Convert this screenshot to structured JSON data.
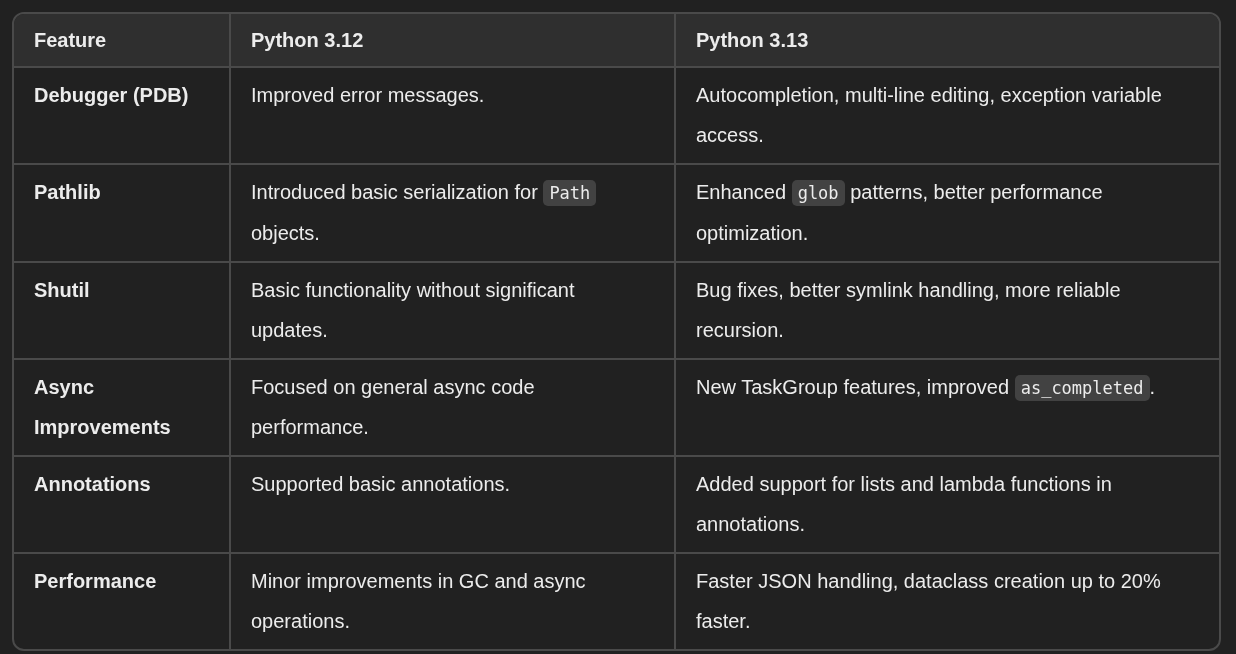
{
  "table": {
    "columns": [
      "Feature",
      "Python 3.12",
      "Python 3.13"
    ],
    "rows": [
      [
        [
          {
            "kind": "text",
            "text": "Debugger (PDB)"
          }
        ],
        [
          {
            "kind": "text",
            "text": "Improved error messages."
          }
        ],
        [
          {
            "kind": "text",
            "text": "Autocompletion, multi-line editing, exception variable access."
          }
        ]
      ],
      [
        [
          {
            "kind": "text",
            "text": "Pathlib"
          }
        ],
        [
          {
            "kind": "text",
            "text": "Introduced basic serialization for "
          },
          {
            "kind": "code",
            "text": "Path"
          },
          {
            "kind": "text",
            "text": " objects."
          }
        ],
        [
          {
            "kind": "text",
            "text": "Enhanced "
          },
          {
            "kind": "code",
            "text": "glob"
          },
          {
            "kind": "text",
            "text": " patterns, better performance optimization."
          }
        ]
      ],
      [
        [
          {
            "kind": "text",
            "text": "Shutil"
          }
        ],
        [
          {
            "kind": "text",
            "text": "Basic functionality without significant updates."
          }
        ],
        [
          {
            "kind": "text",
            "text": "Bug fixes, better symlink handling, more reliable recursion."
          }
        ]
      ],
      [
        [
          {
            "kind": "text",
            "text": "Async Improvements"
          }
        ],
        [
          {
            "kind": "text",
            "text": "Focused on general async code performance."
          }
        ],
        [
          {
            "kind": "text",
            "text": "New TaskGroup features, improved "
          },
          {
            "kind": "code",
            "text": "as_completed"
          },
          {
            "kind": "text",
            "text": "."
          }
        ]
      ],
      [
        [
          {
            "kind": "text",
            "text": "Annotations"
          }
        ],
        [
          {
            "kind": "text",
            "text": "Supported basic annotations."
          }
        ],
        [
          {
            "kind": "text",
            "text": "Added support for lists and lambda functions in annotations."
          }
        ]
      ],
      [
        [
          {
            "kind": "text",
            "text": "Performance"
          }
        ],
        [
          {
            "kind": "text",
            "text": "Minor improvements in GC and async operations."
          }
        ],
        [
          {
            "kind": "text",
            "text": "Faster JSON handling, dataclass creation up to 20% faster."
          }
        ]
      ]
    ]
  }
}
